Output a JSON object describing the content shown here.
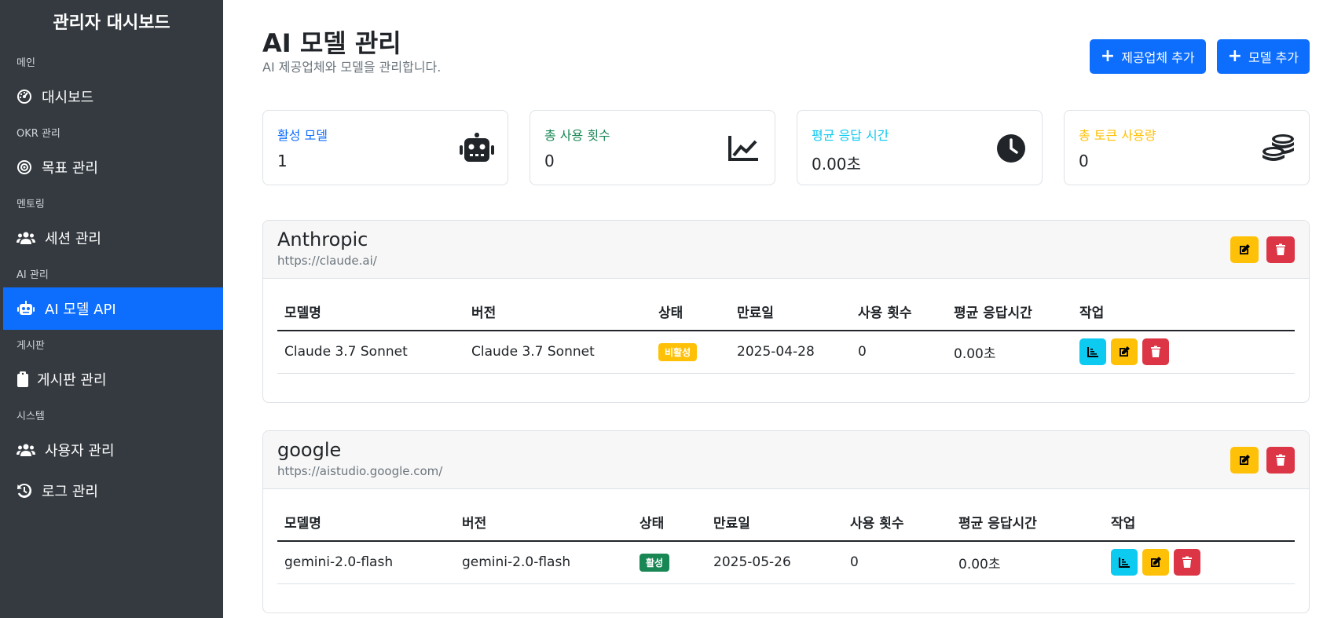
{
  "sidebar": {
    "title": "관리자 대시보드",
    "sections": [
      {
        "label": "메인",
        "items": [
          {
            "label": "대시보드",
            "icon": "tachometer-icon",
            "active": false
          }
        ]
      },
      {
        "label": "OKR 관리",
        "items": [
          {
            "label": "목표 관리",
            "icon": "target-icon",
            "active": false
          }
        ]
      },
      {
        "label": "멘토링",
        "items": [
          {
            "label": "세션 관리",
            "icon": "users-icon",
            "active": false
          }
        ]
      },
      {
        "label": "AI 관리",
        "items": [
          {
            "label": "AI 모델 API",
            "icon": "robot-icon",
            "active": true
          }
        ]
      },
      {
        "label": "게시판",
        "items": [
          {
            "label": "게시판 관리",
            "icon": "clipboard-icon",
            "active": false
          }
        ]
      },
      {
        "label": "시스템",
        "items": [
          {
            "label": "사용자 관리",
            "icon": "users-icon",
            "active": false
          },
          {
            "label": "로그 관리",
            "icon": "history-icon",
            "active": false
          }
        ]
      }
    ]
  },
  "header": {
    "title": "AI 모델 관리",
    "subtitle": "AI 제공업체와 모델을 관리합니다.",
    "add_provider_label": "제공업체 추가",
    "add_model_label": "모델 추가"
  },
  "stats": [
    {
      "label": "활성 모델",
      "value": "1",
      "color": "#0d6efd",
      "icon": "robot-icon"
    },
    {
      "label": "총 사용 횟수",
      "value": "0",
      "color": "#198754",
      "icon": "line-chart-icon"
    },
    {
      "label": "평균 응답 시간",
      "value": "0.00초",
      "color": "#0dcaf0",
      "icon": "clock-icon"
    },
    {
      "label": "총 토큰 사용량",
      "value": "0",
      "color": "#ffc107",
      "icon": "coins-icon"
    }
  ],
  "table_headers": [
    "모델명",
    "버전",
    "상태",
    "만료일",
    "사용 횟수",
    "평균 응답시간",
    "작업"
  ],
  "providers": [
    {
      "name": "Anthropic",
      "url": "https://claude.ai/",
      "models": [
        {
          "name": "Claude 3.7 Sonnet",
          "version": "Claude 3.7 Sonnet",
          "status": "비활성",
          "status_type": "inactive",
          "expires": "2025-04-28",
          "usage": "0",
          "avg_time": "0.00초"
        }
      ]
    },
    {
      "name": "google",
      "url": "https://aistudio.google.com/",
      "models": [
        {
          "name": "gemini-2.0-flash",
          "version": "gemini-2.0-flash",
          "status": "활성",
          "status_type": "active",
          "expires": "2025-05-26",
          "usage": "0",
          "avg_time": "0.00초"
        }
      ]
    }
  ],
  "colors": {
    "sidebar_bg": "#343a40",
    "primary": "#0d6efd",
    "warning": "#ffc107",
    "danger": "#dc3545",
    "info": "#0dcaf0",
    "success": "#198754"
  }
}
